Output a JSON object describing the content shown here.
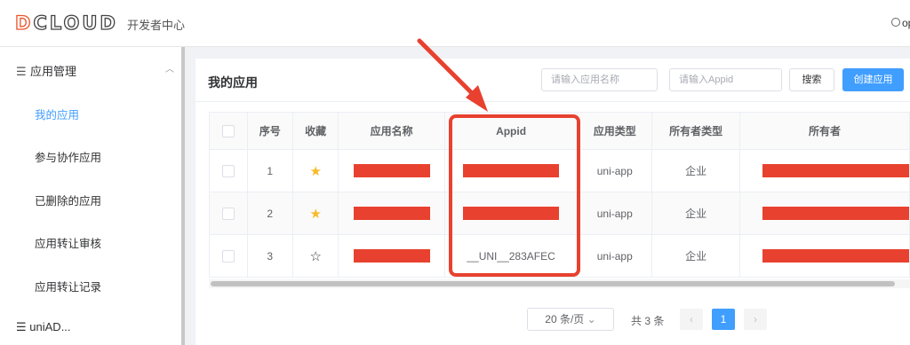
{
  "header": {
    "logo_text": "DCLOUD",
    "subtitle": "开发者中心",
    "user": "op"
  },
  "sidebar": {
    "group_label": "应用管理",
    "items": [
      {
        "label": "我的应用",
        "active": true
      },
      {
        "label": "参与协作应用"
      },
      {
        "label": "已删除的应用"
      },
      {
        "label": "应用转让审核"
      },
      {
        "label": "应用转让记录"
      }
    ],
    "bottom_group": "uniAD..."
  },
  "main": {
    "title": "我的应用",
    "search_name_placeholder": "请输入应用名称",
    "search_appid_placeholder": "请输入Appid",
    "search_button": "搜索",
    "create_button": "创建应用",
    "columns": [
      "序号",
      "收藏",
      "应用名称",
      "Appid",
      "应用类型",
      "所有者类型",
      "所有者"
    ],
    "rows": [
      {
        "index": "1",
        "starred": true,
        "appid_prefix": "__",
        "appid_mid": "__",
        "type": "uni-app",
        "owner_type": "企业"
      },
      {
        "index": "2",
        "starred": true,
        "appid_prefix": "__",
        "appid_mid": "__",
        "type": "uni-app",
        "owner_type": "企业"
      },
      {
        "index": "3",
        "starred": false,
        "appid": "__UNI__283AFEC",
        "type": "uni-app",
        "owner_type": "企业"
      }
    ]
  },
  "pagination": {
    "page_size": "20 条/页",
    "total": "共 3 条",
    "current_page": "1",
    "prev": "‹",
    "next": "›"
  },
  "colors": {
    "accent": "#409eff",
    "annotation_red": "#e8412f",
    "star": "#f7ba2a"
  }
}
